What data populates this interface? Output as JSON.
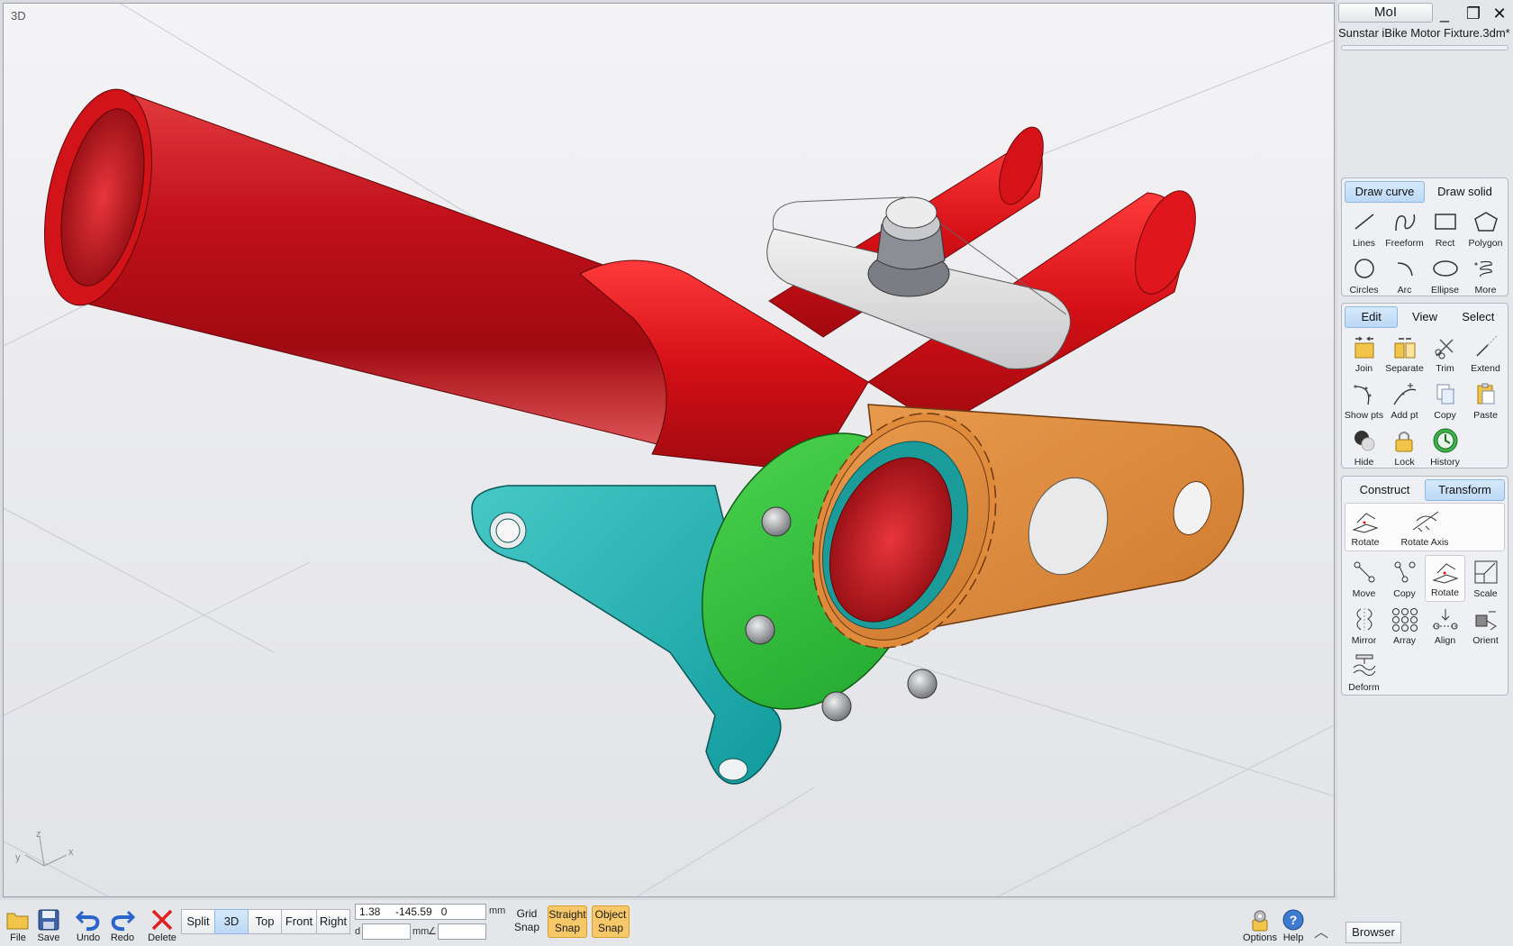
{
  "app": {
    "name": "MoI",
    "filename": "Sunstar iBike Motor Fixture.3dm*"
  },
  "window_controls": {
    "minimize": "_",
    "maximize": "❐",
    "close": "✕"
  },
  "viewport": {
    "label": "3D",
    "axes": {
      "x": "x",
      "y": "y",
      "z": "z"
    }
  },
  "draw_panel": {
    "tabs": [
      {
        "label": "Draw curve",
        "active": true
      },
      {
        "label": "Draw solid",
        "active": false
      }
    ],
    "tools": [
      {
        "label": "Lines",
        "icon": "line-icon"
      },
      {
        "label": "Freeform",
        "icon": "freeform-icon"
      },
      {
        "label": "Rect",
        "icon": "rect-icon"
      },
      {
        "label": "Polygon",
        "icon": "polygon-icon"
      },
      {
        "label": "Circles",
        "icon": "circle-icon"
      },
      {
        "label": "Arc",
        "icon": "arc-icon"
      },
      {
        "label": "Ellipse",
        "icon": "ellipse-icon"
      },
      {
        "label": "More",
        "icon": "helix-icon"
      }
    ]
  },
  "edit_panel": {
    "tabs": [
      {
        "label": "Edit",
        "active": true
      },
      {
        "label": "View",
        "active": false
      },
      {
        "label": "Select",
        "active": false
      }
    ],
    "tools": [
      {
        "label": "Join",
        "icon": "join-icon"
      },
      {
        "label": "Separate",
        "icon": "separate-icon"
      },
      {
        "label": "Trim",
        "icon": "scissors-icon"
      },
      {
        "label": "Extend",
        "icon": "extend-icon"
      },
      {
        "label": "Show pts",
        "icon": "show-points-icon"
      },
      {
        "label": "Add pt",
        "icon": "add-point-icon"
      },
      {
        "label": "Copy",
        "icon": "copy-icon"
      },
      {
        "label": "Paste",
        "icon": "paste-icon"
      },
      {
        "label": "Hide",
        "icon": "hide-icon"
      },
      {
        "label": "Lock",
        "icon": "lock-icon"
      },
      {
        "label": "History",
        "icon": "history-icon"
      }
    ]
  },
  "transform_panel": {
    "tabs": [
      {
        "label": "Construct",
        "active": false
      },
      {
        "label": "Transform",
        "active": true
      }
    ],
    "sub_tools": [
      {
        "label": "Rotate",
        "icon": "rotate-icon"
      },
      {
        "label": "Rotate Axis",
        "icon": "rotate-axis-icon"
      }
    ],
    "tools": [
      {
        "label": "Move",
        "icon": "move-icon"
      },
      {
        "label": "Copy",
        "icon": "copy-transform-icon"
      },
      {
        "label": "Rotate",
        "icon": "rotate-icon",
        "selected": true
      },
      {
        "label": "Scale",
        "icon": "scale-icon"
      },
      {
        "label": "Mirror",
        "icon": "mirror-icon"
      },
      {
        "label": "Array",
        "icon": "array-icon"
      },
      {
        "label": "Align",
        "icon": "align-icon"
      },
      {
        "label": "Orient",
        "icon": "orient-icon"
      },
      {
        "label": "Deform",
        "icon": "deform-icon"
      }
    ]
  },
  "bottom": {
    "file": "File",
    "save": "Save",
    "undo": "Undo",
    "redo": "Redo",
    "delete": "Delete",
    "views": [
      {
        "label": "Split",
        "active": false
      },
      {
        "label": "3D",
        "active": true
      },
      {
        "label": "Top",
        "active": false
      },
      {
        "label": "Front",
        "active": false
      },
      {
        "label": "Right",
        "active": false
      }
    ],
    "coords": "1.38     -145.59   0",
    "unit": "mm",
    "distance_label": "d",
    "distance_unit": "mm",
    "angle_label": "∠",
    "grid_snap": [
      "Grid",
      "Snap"
    ],
    "straight_snap": [
      "Straight",
      "Snap"
    ],
    "object_snap": [
      "Object",
      "Snap"
    ],
    "options": "Options",
    "help": "Help",
    "browser": "Browser"
  },
  "colors": {
    "red": "#d0141b",
    "orange": "#e08a3c",
    "teal": "#1fb0b0",
    "green": "#2dbf3a",
    "accent": "#bcd8f5",
    "snap": "#f7c86a"
  }
}
